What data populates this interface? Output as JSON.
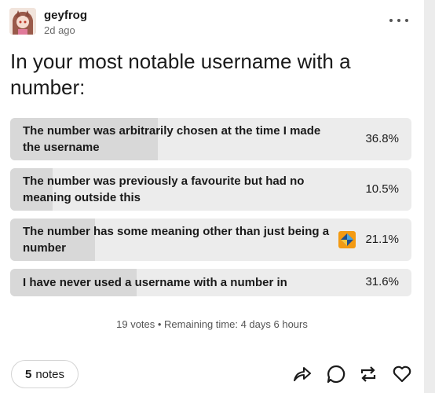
{
  "post": {
    "username": "geyfrog",
    "timestamp": "2d ago",
    "title": "In your most notable username with a number:",
    "more_icon": "ellipsis-icon"
  },
  "poll": {
    "options": [
      {
        "label": "The number was arbitrarily chosen at the time I made the username",
        "percent": "36.8%",
        "fraction": 0.368
      },
      {
        "label": "The number was previously a favourite but had no meaning outside this",
        "percent": "10.5%",
        "fraction": 0.105
      },
      {
        "label": "The number has some meaning other than just being a number",
        "percent": "21.1%",
        "fraction": 0.211,
        "selected_icon": "vote-marker-icon"
      },
      {
        "label": "I have never used a username with a number in",
        "percent": "31.6%",
        "fraction": 0.316
      }
    ],
    "meta": "19 votes • Remaining time: 4 days 6 hours"
  },
  "footer": {
    "notes_count": "5",
    "notes_label": "notes",
    "actions": [
      "share-icon",
      "reply-icon",
      "reblog-icon",
      "like-icon"
    ]
  },
  "colors": {
    "option_bg": "#ececec",
    "option_fill": "#d8d8d8",
    "vote_marker": "#f39a12"
  }
}
